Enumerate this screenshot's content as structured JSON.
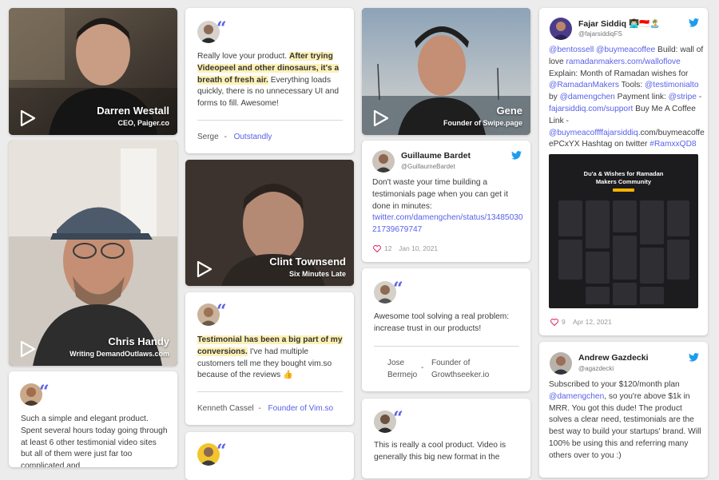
{
  "colors": {
    "accent": "#5961e8",
    "highlight": "#fdf1b6",
    "twitter": "#1d9bf0",
    "heart": "#e0245e"
  },
  "video_darren": {
    "name": "Darren Westall",
    "role": "CEO, Paiger.co",
    "icon": "play-icon"
  },
  "video_chris": {
    "name": "Chris Handy",
    "role": "Writing DemandOutlaws.com",
    "icon": "play-icon"
  },
  "video_clint": {
    "name": "Clint Townsend",
    "role": "Six Minutes Late",
    "icon": "play-icon"
  },
  "video_gene": {
    "name": "Gene",
    "role": "Founder of Swipe.page",
    "icon": "play-icon"
  },
  "card_serge": {
    "hl": "After trying Videopeel and other dinosaurs, it's a breath of fresh air.",
    "pre": "Really love your product.",
    "post": "Everything loads quickly, there is no unnecessary UI and forms to fill. Awesome!",
    "author": "Serge",
    "sep": "-",
    "company": "Outstandly"
  },
  "card_kenneth": {
    "hl": "Testimonial has been a big part of my conversions.",
    "post": "I've had multiple customers tell me they bought vim.so because of the reviews 👍",
    "author": "Kenneth Cassel",
    "sep": "-",
    "company": "Founder of Vim.so"
  },
  "card_simple": {
    "text": "Such a simple and elegant product. Spent several hours today going through at least 6 other testimonial video sites but all of them were just far too complicated and"
  },
  "card_jose": {
    "text": "Awesome tool solving a real problem: increase trust in our products!",
    "author_line1": "Jose",
    "author_line2": "Bermejo",
    "sep": "-",
    "company_line1": "Founder of",
    "company_line2": "Growthseeker.io"
  },
  "card_cool": {
    "text": "This is really a cool product. Video is generally this big new format in the"
  },
  "tweet_guillaume": {
    "name": "Guillaume Bardet",
    "handle": "@GuillaumeBardet",
    "text": "Don't waste your time building a testimonials page when you can get it done in minutes:",
    "link1": "twitter.com/damengchen/status/13485030",
    "link2": "21739679747",
    "likes": "12",
    "date": "Jan 10, 2021"
  },
  "tweet_fajar": {
    "name": "Fajar Siddiq 👨🏻‍💻🇮🇩🏝️",
    "handle": "@fajarsiddiqFS",
    "lines": [
      [
        {
          "t": "@bentossell @buymeacoffee",
          "l": true
        },
        {
          "t": " Build: wall of",
          "l": false
        }
      ],
      [
        {
          "t": "love ",
          "l": false
        },
        {
          "t": "ramadanmakers.com/walloflove",
          "l": true
        }
      ],
      [
        {
          "t": "Explain: Month of Ramadan wishes for",
          "l": false
        }
      ],
      [
        {
          "t": "@RamadanMakers",
          "l": true
        },
        {
          "t": " Tools: ",
          "l": false
        },
        {
          "t": "@testimonialto",
          "l": true
        }
      ],
      [
        {
          "t": "by ",
          "l": false
        },
        {
          "t": "@damengchen",
          "l": true
        },
        {
          "t": " Payment link: ",
          "l": false
        },
        {
          "t": "@stripe",
          "l": true
        },
        {
          "t": " -",
          "l": false
        }
      ],
      [
        {
          "t": "fajarsiddiq.com/support",
          "l": true
        },
        {
          "t": " Buy Me A Coffee",
          "l": false
        }
      ],
      [
        {
          "t": "Link -",
          "l": false
        }
      ],
      [
        {
          "t": "@buymeacoffffajarsiddiq",
          "l": true
        },
        {
          "t": ".com/buymeacoffe",
          "l": false
        }
      ],
      [
        {
          "t": "ePCxYX Hashtag on twitter ",
          "l": false
        },
        {
          "t": "#RamxxQD8",
          "l": true
        }
      ]
    ],
    "image_title1": "Du'a & Wishes for Ramadan",
    "image_title2": "Makers Community",
    "likes": "9",
    "date": "Apr 12, 2021"
  },
  "tweet_andrew": {
    "name": "Andrew Gazdecki",
    "handle": "@agazdecki",
    "line1_pre": "Subscribed to your $120/month plan",
    "mention": "@damengchen",
    "line2_post": ", so you're above $1k in",
    "rest": "MRR. You got this dude! The product solves a clear need, testimonials are the best way to build your startups' brand. Will 100% be using this and referring many others over to you :)"
  }
}
